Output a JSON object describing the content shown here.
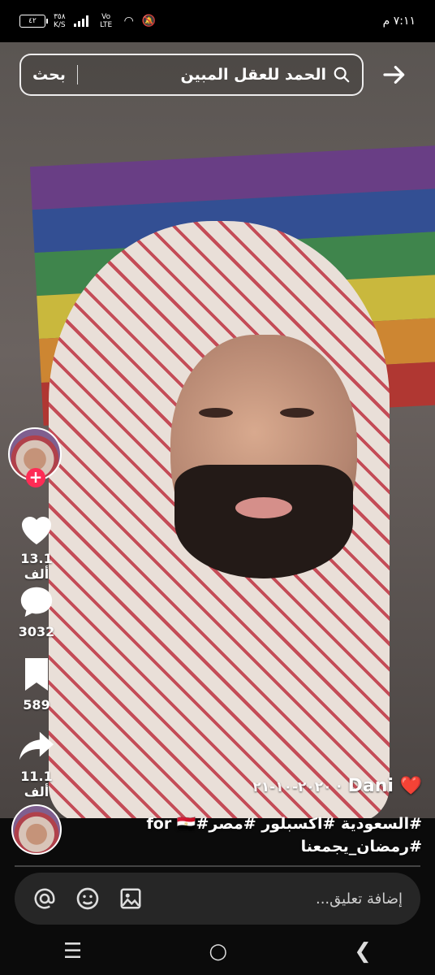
{
  "status_bar": {
    "time": "٧:١١ م",
    "battery": "٤٢",
    "speed_value": "٣٥٨",
    "speed_unit": "K/S",
    "network": "Vo LTE"
  },
  "search": {
    "query": "الحمد للعقل المبين",
    "submit_label": "بحث"
  },
  "actions": {
    "likes": "13.1 ألف",
    "comments": "3032",
    "saves": "589",
    "shares": "11.1 ألف"
  },
  "video": {
    "author": "Dani",
    "date": "٢٠٢٠-١٠-٢١",
    "hashtags_line1": "#السعودية #اكسبلور #مصر#for",
    "hashtags_line2": "#رمضان_يجمعنا"
  },
  "comment": {
    "placeholder": "إضافة تعليق..."
  },
  "colors": {
    "follow": "#fe2c55",
    "flag": [
      "#6a3b8a",
      "#2e4e9a",
      "#3b8a4b",
      "#d4c23a",
      "#d88a2e",
      "#b8332e"
    ]
  }
}
